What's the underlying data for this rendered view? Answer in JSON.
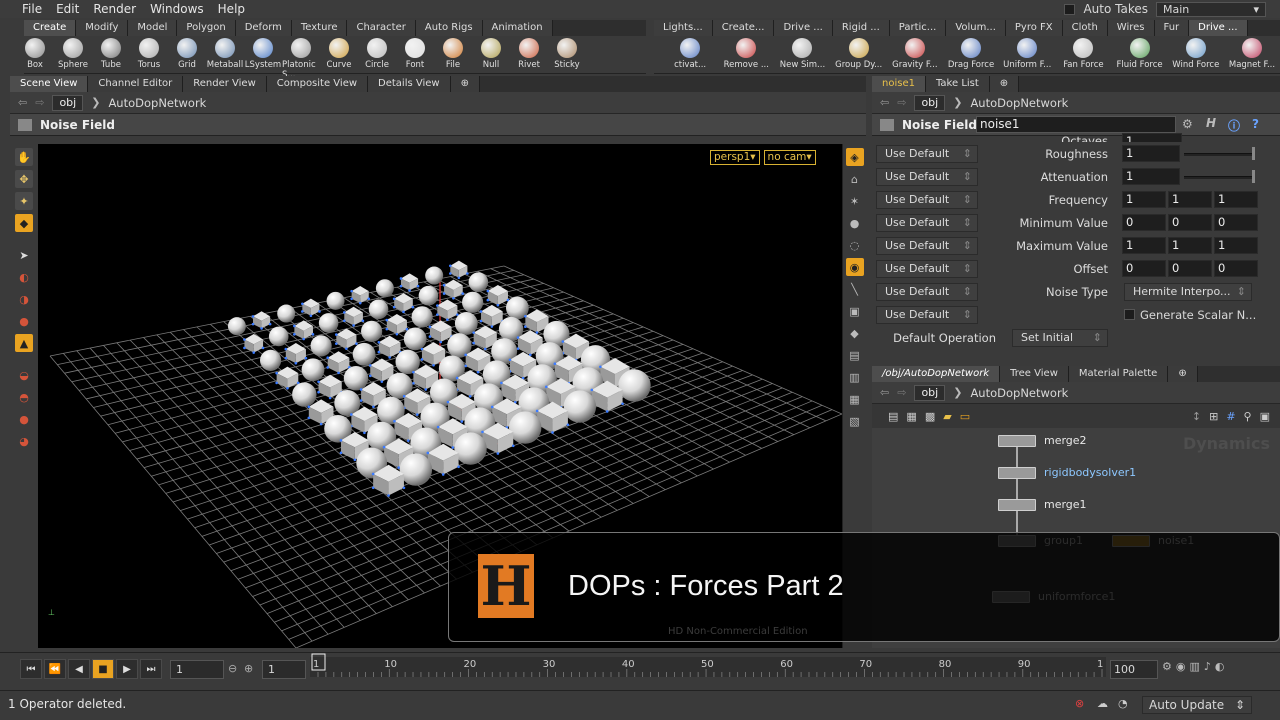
{
  "menu": {
    "items": [
      "File",
      "Edit",
      "Render",
      "Windows",
      "Help"
    ],
    "auto_takes": "Auto Takes",
    "take_select": "Main"
  },
  "shelf_left": {
    "tabs": [
      "Create",
      "Modify",
      "Model",
      "Polygon",
      "Deform",
      "Texture",
      "Character",
      "Auto Rigs",
      "Animation"
    ],
    "tools": [
      "Box",
      "Sphere",
      "Tube",
      "Torus",
      "Grid",
      "Metaball",
      "LSystem",
      "Platonic S...",
      "Curve",
      "Circle",
      "Font",
      "File",
      "Null",
      "Rivet",
      "Sticky"
    ]
  },
  "shelf_right": {
    "tabs": [
      "Lights...",
      "Create...",
      "Drive ...",
      "Rigid ...",
      "Partic...",
      "Volum...",
      "Pyro FX",
      "Cloth",
      "Wires",
      "Fur",
      "Drive ..."
    ],
    "tools": [
      "ctivat...",
      "Remove ...",
      "New Sim...",
      "Group Dy...",
      "Gravity F...",
      "Drag Force",
      "Uniform F...",
      "Fan Force",
      "Fluid Force",
      "Wind Force",
      "Magnet F..."
    ]
  },
  "left_pane": {
    "tabs": [
      "Scene View",
      "Channel Editor",
      "Render View",
      "Composite View",
      "Details View"
    ],
    "path": [
      "obj",
      "AutoDopNetwork"
    ],
    "title": "Noise Field",
    "cam_menu": "persp1",
    "cam_select": "no cam"
  },
  "params_pane": {
    "tabs": [
      "noise1",
      "Take List"
    ],
    "path": [
      "obj",
      "AutoDopNetwork"
    ],
    "title": "Noise Field",
    "node_name": "noise1",
    "use_default": "Use Default",
    "partial_label": "Octaves",
    "partial_value": "1",
    "rows": [
      {
        "label": "Roughness",
        "values": [
          "1"
        ],
        "slider": true
      },
      {
        "label": "Attenuation",
        "values": [
          "1"
        ],
        "slider": true
      },
      {
        "label": "Frequency",
        "values": [
          "1",
          "1",
          "1"
        ]
      },
      {
        "label": "Minimum Value",
        "values": [
          "0",
          "0",
          "0"
        ]
      },
      {
        "label": "Maximum Value",
        "values": [
          "1",
          "1",
          "1"
        ]
      },
      {
        "label": "Offset",
        "values": [
          "0",
          "0",
          "0"
        ]
      }
    ],
    "noise_type_label": "Noise Type",
    "noise_type_value": "Hermite Interpo...",
    "generate_scalar": "Generate Scalar N...",
    "default_op_label": "Default Operation",
    "default_op_value": "Set Initial"
  },
  "network_pane": {
    "tabs": [
      "/obj/AutoDopNetwork",
      "Tree View",
      "Material Palette"
    ],
    "path": [
      "obj",
      "AutoDopNetwork"
    ],
    "watermark": "Dynamics",
    "nodes": [
      "merge2",
      "rigidbodysolver1",
      "merge1",
      "group1",
      "noise1",
      "uniformforce1"
    ]
  },
  "overlay": {
    "logo_letter": "H",
    "title": "DOPs : Forces Part 2",
    "watermark": "HD Non-Commercial Edition"
  },
  "timeline": {
    "frame_value": "1",
    "start_value": "1",
    "ticks": [
      "1",
      "10",
      "20",
      "30",
      "40",
      "50",
      "60",
      "70",
      "80",
      "90",
      "1"
    ],
    "end_value": "100"
  },
  "status": {
    "message": "1 Operator deleted.",
    "update_mode": "Auto Update"
  },
  "colors": {
    "accent": "#e9a321",
    "logo": "#e27a23",
    "node_text_selected": "#8ec8ff"
  }
}
